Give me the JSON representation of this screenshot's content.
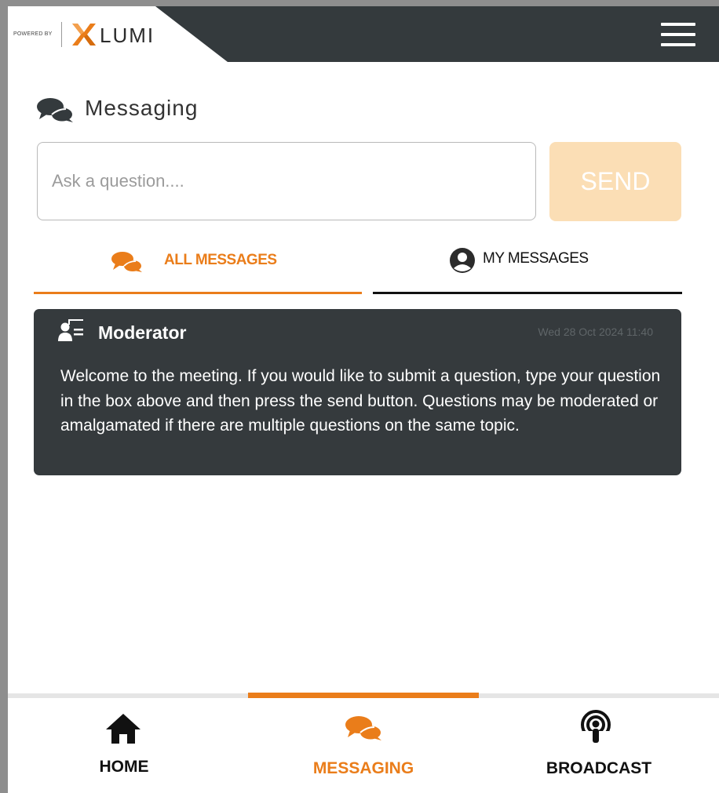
{
  "header": {
    "powered_by": "POWERED BY",
    "brand_name": "LUMI",
    "menu_icon": "hamburger-menu-icon"
  },
  "messaging": {
    "title": "Messaging",
    "title_icon": "chat-bubbles-icon",
    "input_placeholder": "Ask a question....",
    "input_value": "",
    "send_label": "SEND"
  },
  "tabs": [
    {
      "label": "ALL MESSAGES",
      "icon": "chat-bubbles-icon",
      "active": true
    },
    {
      "label": "MY MESSAGES",
      "icon": "user-circle-icon",
      "active": false
    }
  ],
  "messages": [
    {
      "sender": "Moderator",
      "sender_icon": "moderator-icon",
      "timestamp": "Wed 28 Oct 2024 11:40",
      "body": "Welcome to the meeting. If you would like to submit a question, type your question in the box above and then press the send button. Questions may be moderated or amalgamated if there are multiple questions on the same topic."
    }
  ],
  "bottom_nav": [
    {
      "label": "HOME",
      "icon": "home-icon",
      "active": false
    },
    {
      "label": "MESSAGING",
      "icon": "chat-bubbles-icon",
      "active": true
    },
    {
      "label": "BROADCAST",
      "icon": "podcast-icon",
      "active": false
    }
  ],
  "colors": {
    "accent": "#ea7d1a",
    "header_bg": "#343a3d",
    "send_disabled_bg": "#fbdeb5",
    "card_bg": "#353a3d"
  }
}
